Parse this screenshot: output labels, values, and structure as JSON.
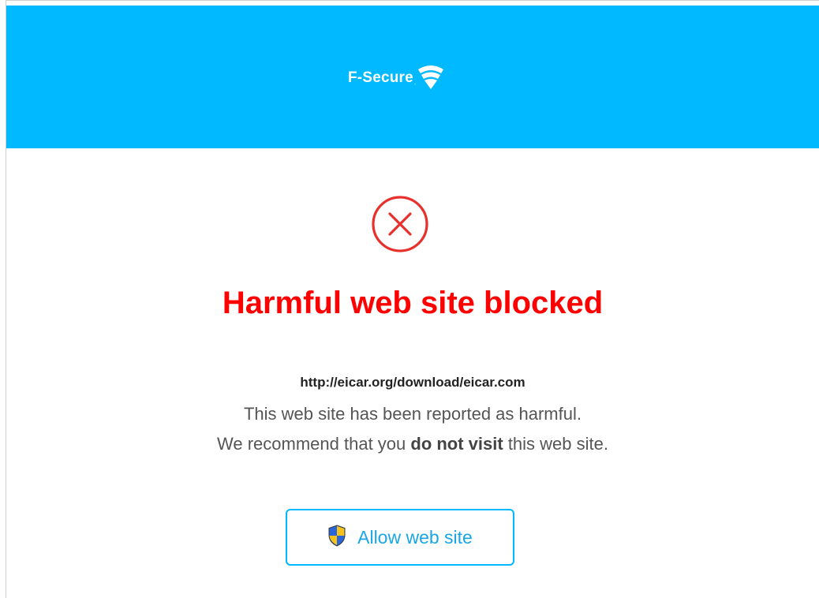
{
  "brand": {
    "name": "F-Secure",
    "dot": ".",
    "logo_icon": "wifi-fan-logo-icon",
    "header_color": "#00b9ff"
  },
  "alert": {
    "icon": "circle-x-icon",
    "icon_color": "#e8302d",
    "title": "Harmful web site blocked",
    "title_color": "#ff0000",
    "url": "http://eicar.org/download/eicar.com",
    "message_line1": "This web site has been reported as harmful.",
    "message_line2_before": "We recommend that you ",
    "message_line2_bold": "do not visit",
    "message_line2_after": " this web site."
  },
  "actions": {
    "allow_label": "Allow web site",
    "allow_icon": "uac-shield-icon",
    "accent_color": "#00b9ff"
  }
}
